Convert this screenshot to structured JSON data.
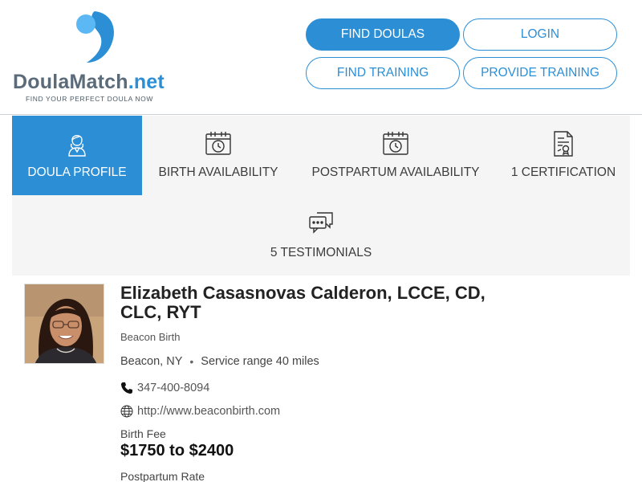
{
  "brand": {
    "name_main": "DoulaMatch",
    "name_suffix": ".net",
    "tagline": "FIND YOUR PERFECT DOULA NOW",
    "primary_color": "#2c8fd6",
    "accent_color": "#5bb8f5"
  },
  "nav": {
    "find_doulas": "FIND DOULAS",
    "login": "LOGIN",
    "find_training": "FIND TRAINING",
    "provide_training": "PROVIDE TRAINING"
  },
  "tabs": [
    {
      "label": "DOULA PROFILE",
      "icon": "doula-person-icon",
      "active": true
    },
    {
      "label": "BIRTH AVAILABILITY",
      "icon": "calendar-clock-icon",
      "active": false
    },
    {
      "label": "POSTPARTUM AVAILABILITY",
      "icon": "calendar-clock-icon",
      "active": false
    },
    {
      "label": "1 CERTIFICATION",
      "icon": "certificate-icon",
      "active": false
    },
    {
      "label": "5 TESTIMONIALS",
      "icon": "chat-bubbles-icon",
      "active": false
    }
  ],
  "profile": {
    "name": "Elizabeth Casasnovas Calderon, LCCE, CD, CLC, RYT",
    "business": "Beacon Birth",
    "location": "Beacon, NY",
    "separator": "•",
    "service_range": "Service range 40 miles",
    "phone": "347-400-8094",
    "website": "http://www.beaconbirth.com",
    "birth_fee_label": "Birth Fee",
    "birth_fee_value": "$1750 to $2400",
    "postpartum_rate_label": "Postpartum Rate"
  }
}
